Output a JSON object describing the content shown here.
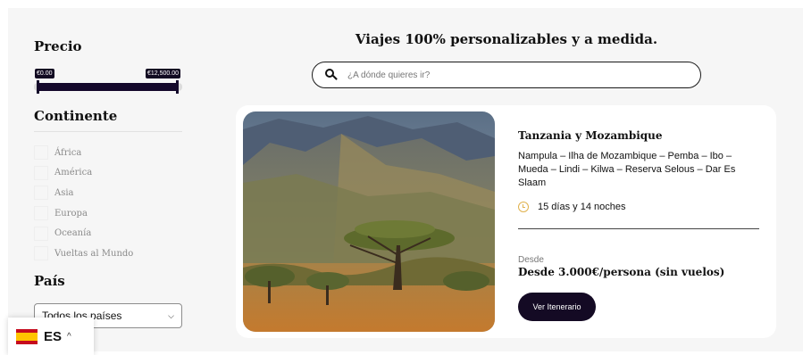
{
  "sidebar": {
    "price": {
      "title": "Precio",
      "min_label": "€0.00",
      "max_label": "€12,500.00",
      "range_selected": [
        0,
        12500
      ],
      "range_max": 12500
    },
    "continent": {
      "title": "Continente",
      "items": [
        {
          "label": "África",
          "checked": false
        },
        {
          "label": "América",
          "checked": false
        },
        {
          "label": "Asia",
          "checked": false
        },
        {
          "label": "Europa",
          "checked": false
        },
        {
          "label": "Oceanía",
          "checked": false
        },
        {
          "label": "Vueltas al Mundo",
          "checked": false
        }
      ]
    },
    "country": {
      "title": "País",
      "selected": "Todos los países"
    }
  },
  "language": {
    "code": "ES",
    "flag_icon": "spain-flag-icon",
    "caret_icon": "chevron-up-icon"
  },
  "main": {
    "headline": "Viajes 100% personalizables y a medida.",
    "search": {
      "placeholder": "¿A dónde quieres ir?",
      "value": "",
      "icon": "search-icon"
    },
    "card": {
      "title": "Tanzania y Mozambique",
      "route": "Nampula – Ilha de Mozambique – Pemba – Ibo – Mueda – Lindi – Kilwa – Reserva Selous – Dar Es Slaam",
      "duration_icon": "clock-icon",
      "duration": "15 días y 14 noches",
      "from_label": "Desde",
      "price": "Desde 3.000€/persona (sin vuelos)",
      "cta": "Ver Itenerario"
    }
  },
  "colors": {
    "brand_dark": "#140a24",
    "clock_accent": "#e0b24e",
    "background": "#f6f6f6"
  }
}
